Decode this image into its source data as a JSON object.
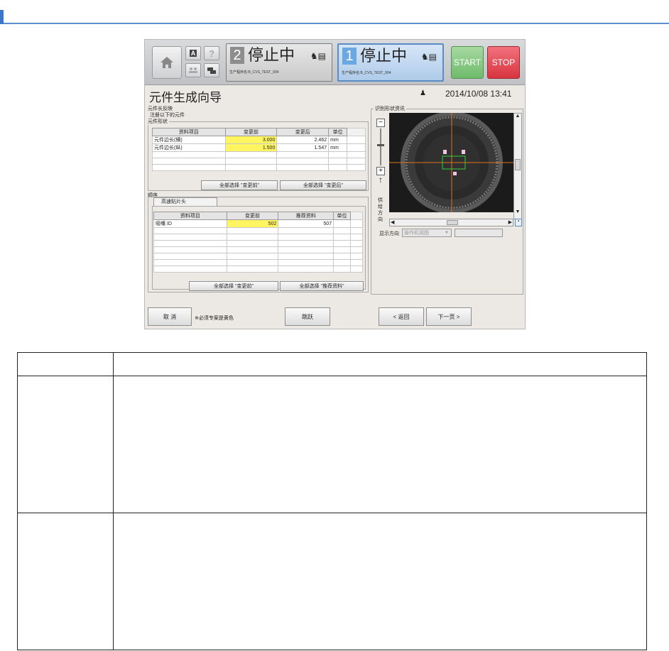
{
  "header": {
    "lane2": {
      "number": "2",
      "state": "停止中",
      "program": "生产程序名:B_CVS_TEST_004"
    },
    "lane1": {
      "number": "1",
      "state": "停止中",
      "program": "生产程序名:B_CVS_TEST_004"
    },
    "start_label": "START",
    "stop_label": "STOP",
    "help_label": "?",
    "a_label": "A"
  },
  "page": {
    "title": "元件生成向导",
    "datetime": "2014/10/08 13:41"
  },
  "group1": {
    "title": "元件长反映",
    "subtitle": "注册以下的元件",
    "shape_label": "元件形状",
    "columns": [
      "资料项目",
      "变更前",
      "变更后",
      "单位"
    ],
    "rows": [
      [
        "元件边长(横)",
        "3.000",
        "2.462",
        "mm"
      ],
      [
        "元件边长(纵)",
        "1.500",
        "1.547",
        "mm"
      ]
    ],
    "btn_before": "全部选择 \"变更前\"",
    "btn_after": "全部选择 \"变更后\""
  },
  "group2": {
    "title": "顺序",
    "tab": "高速贴片头",
    "columns": [
      "资料项目",
      "变更前",
      "推荐资料",
      "单位"
    ],
    "rows": [
      [
        "吸嘴 ID",
        "502",
        "507",
        ""
      ]
    ],
    "btn_before": "全部选择 \"变更前\"",
    "btn_recommend": "全部选择 \"推荐资料\""
  },
  "camera": {
    "title": "识别形状资讯",
    "feed_label": [
      "供",
      "给",
      "方",
      "向"
    ],
    "display_dir_label": "显示方向",
    "display_dir_value": "操作机视图"
  },
  "footer": {
    "cancel": "取 消",
    "note": "※必须专案是黄色",
    "skip": "跳跃",
    "back": "< 返回",
    "next": "下一页 >"
  }
}
